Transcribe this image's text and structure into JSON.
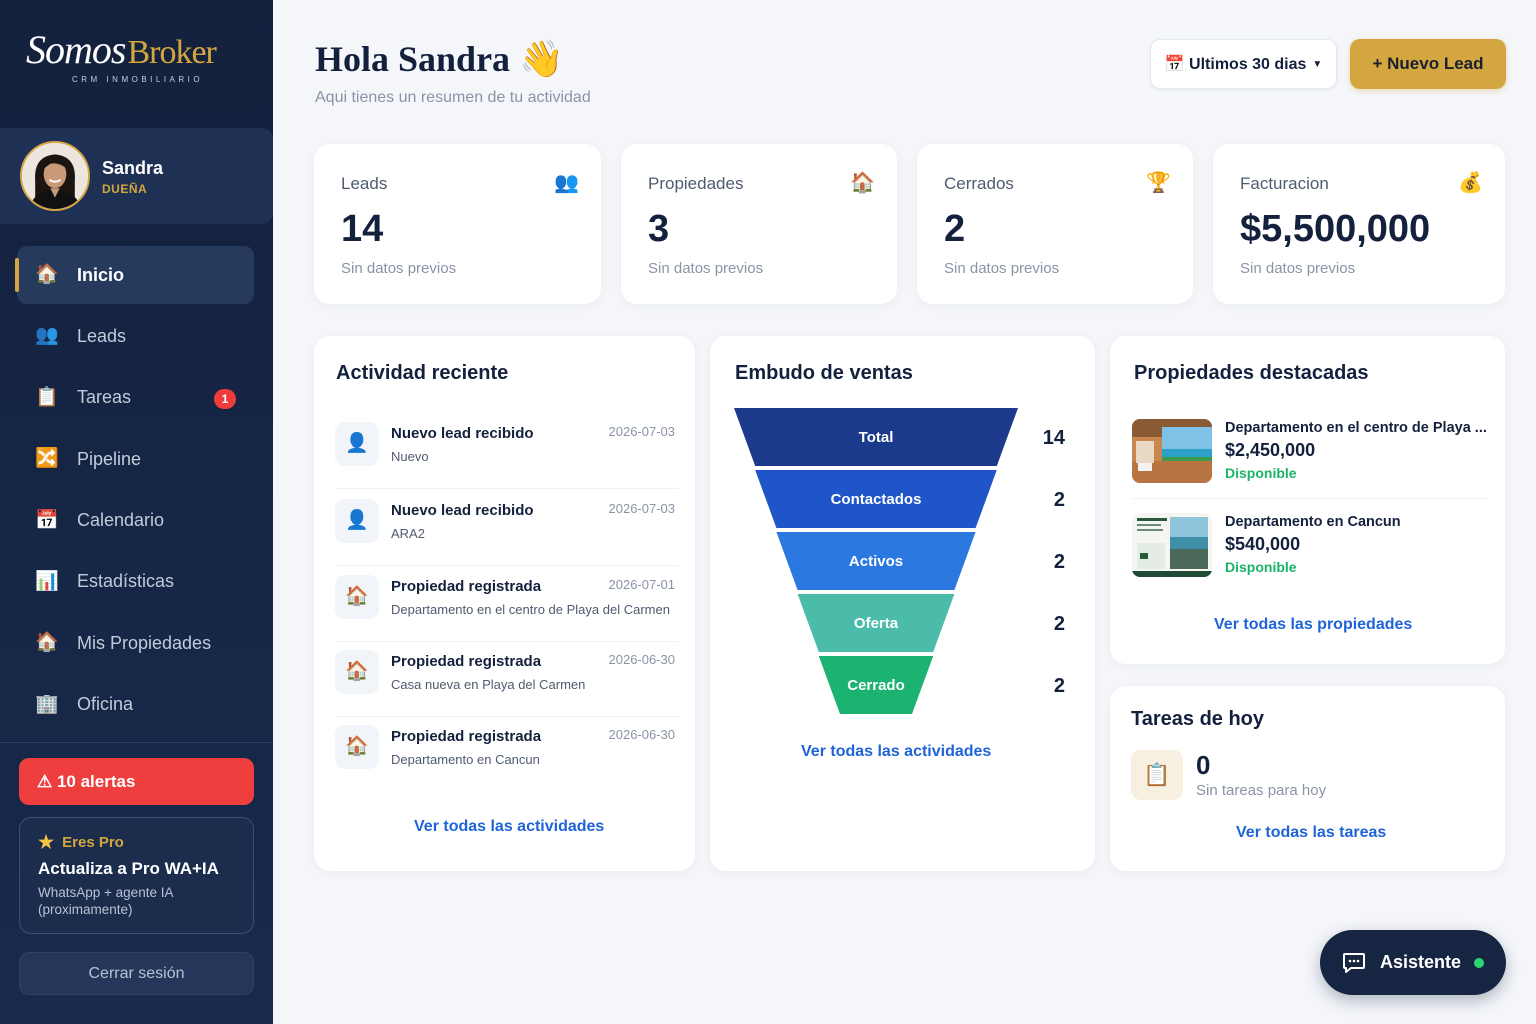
{
  "brand": {
    "name_script": "Somos",
    "name_serif": "Broker",
    "tagline": "CRM INMOBILIARIO",
    "accent": "#d4a640",
    "sidebar_bg": "#14213d"
  },
  "profile": {
    "name": "Sandra",
    "role": "DUEÑA"
  },
  "nav": [
    {
      "label": "Inicio",
      "icon": "house-icon",
      "glyph": "🏠",
      "active": true
    },
    {
      "label": "Leads",
      "icon": "users-icon",
      "glyph": "👥"
    },
    {
      "label": "Tareas",
      "icon": "clipboard-icon",
      "glyph": "📋",
      "badge": "1"
    },
    {
      "label": "Pipeline",
      "icon": "pipeline-icon",
      "glyph": "🔀"
    },
    {
      "label": "Calendario",
      "icon": "calendar-icon",
      "glyph": "📅"
    },
    {
      "label": "Estadísticas",
      "icon": "bar-chart-icon",
      "glyph": "📊"
    },
    {
      "label": "Mis Propiedades",
      "icon": "house-icon",
      "glyph": "🏠"
    },
    {
      "label": "Oficina",
      "icon": "office-icon",
      "glyph": "🏢"
    }
  ],
  "alerts": {
    "label": "⚠ 10 alertas",
    "color": "#ef3e3e"
  },
  "pro": {
    "badge": "Eres Pro",
    "title": "Actualiza a Pro WA+IA",
    "desc": "WhatsApp + agente IA (proximamente)"
  },
  "logout": "Cerrar sesión",
  "header": {
    "greeting": "Hola Sandra 👋",
    "subtitle": "Aqui tienes un resumen de tu actividad",
    "date_range": "📅 Ultimos 30 dias",
    "new_lead": "+ Nuevo Lead"
  },
  "stats": [
    {
      "label": "Leads",
      "glyph": "👥",
      "value": "14",
      "note": "Sin datos previos"
    },
    {
      "label": "Propiedades",
      "glyph": "🏠",
      "value": "3",
      "note": "Sin datos previos"
    },
    {
      "label": "Cerrados",
      "glyph": "🏆",
      "value": "2",
      "note": "Sin datos previos"
    },
    {
      "label": "Facturacion",
      "glyph": "💰",
      "value": "$5,500,000",
      "note": "Sin datos previos"
    }
  ],
  "activity": {
    "title": "Actividad reciente",
    "items": [
      {
        "glyph": "👤",
        "title": "Nuevo lead recibido",
        "sub": "Nuevo",
        "date": "2026-07-03"
      },
      {
        "glyph": "👤",
        "title": "Nuevo lead recibido",
        "sub": "ARA2",
        "date": "2026-07-03"
      },
      {
        "glyph": "🏠",
        "title": "Propiedad registrada",
        "sub": "Departamento en el centro de Playa del Carmen",
        "date": "2026-07-01"
      },
      {
        "glyph": "🏠",
        "title": "Propiedad registrada",
        "sub": "Casa nueva en Playa del Carmen",
        "date": "2026-06-30"
      },
      {
        "glyph": "🏠",
        "title": "Propiedad registrada",
        "sub": "Departamento en Cancun",
        "date": "2026-06-30"
      }
    ],
    "link": "Ver todas las actividades"
  },
  "funnel": {
    "title": "Embudo de ventas",
    "link": "Ver todas las actividades",
    "colors": [
      "#1c3a8c",
      "#1f55c8",
      "#2a78e0",
      "#4cbcaa",
      "#1cb372"
    ]
  },
  "chart_data": {
    "type": "bar",
    "categories": [
      "Total",
      "Contactados",
      "Activos",
      "Oferta",
      "Cerrado"
    ],
    "values": [
      14,
      2,
      2,
      2,
      2
    ]
  },
  "properties": {
    "title": "Propiedades destacadas",
    "items": [
      {
        "name": "Departamento en el centro de Playa ...",
        "price": "$2,450,000",
        "status": "Disponible"
      },
      {
        "name": "Departamento en Cancun",
        "price": "$540,000",
        "status": "Disponible"
      }
    ],
    "link": "Ver todas las propiedades"
  },
  "tasks": {
    "title": "Tareas de hoy",
    "glyph": "📋",
    "count": "0",
    "note": "Sin tareas para hoy",
    "link": "Ver todas las tareas"
  },
  "assistant": {
    "label": "Asistente"
  }
}
